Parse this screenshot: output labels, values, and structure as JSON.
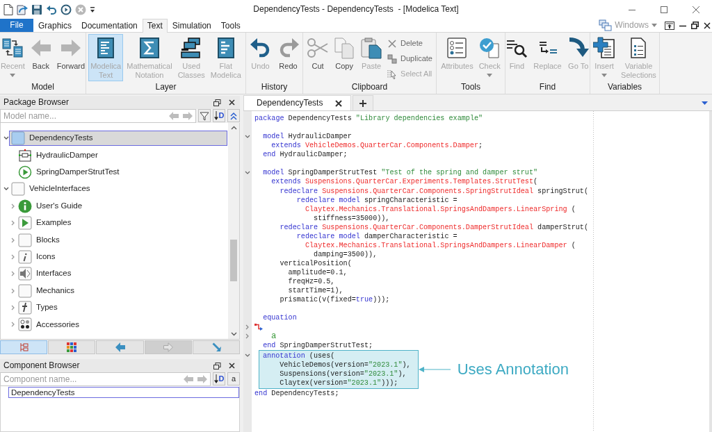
{
  "title_bar": {
    "title": "DependencyTests - DependencyTests  - [Modelica Text]"
  },
  "ribbon_tabs": [
    {
      "label": "File",
      "kind": "file",
      "selected": false
    },
    {
      "label": "Graphics",
      "kind": "tab",
      "selected": false
    },
    {
      "label": "Documentation",
      "kind": "tab",
      "selected": false
    },
    {
      "label": "Text",
      "kind": "tab",
      "selected": true
    },
    {
      "label": "Simulation",
      "kind": "tab",
      "selected": false
    },
    {
      "label": "Tools",
      "kind": "tab",
      "selected": false
    }
  ],
  "window_menu": {
    "label": "Windows",
    "disabled": true
  },
  "ribbon_groups": [
    {
      "label": "Model",
      "buttons": [
        {
          "label": "Recent",
          "kind": "large",
          "disabled": true,
          "dropdown": true
        },
        {
          "label": "Back",
          "kind": "large",
          "disabled": false
        },
        {
          "label": "Forward",
          "kind": "large",
          "disabled": false
        }
      ]
    },
    {
      "label": "Layer",
      "buttons": [
        {
          "label": "Modelica\nText",
          "kind": "large",
          "disabled": true,
          "selected": true
        },
        {
          "label": "Mathematical\nNotation",
          "kind": "large",
          "disabled": true,
          "selected": false
        },
        {
          "label": "Used\nClasses",
          "kind": "large",
          "disabled": true,
          "selected": false
        },
        {
          "label": "Flat\nModelica",
          "kind": "large",
          "disabled": true,
          "selected": false
        }
      ]
    },
    {
      "label": "History",
      "buttons": [
        {
          "label": "Undo",
          "kind": "large",
          "disabled": true
        },
        {
          "label": "Redo",
          "kind": "large",
          "disabled": false
        }
      ]
    },
    {
      "label": "Clipboard",
      "buttons": [
        {
          "label": "Cut",
          "kind": "large",
          "disabled": false
        },
        {
          "label": "Copy",
          "kind": "large",
          "disabled": false
        },
        {
          "label": "Paste",
          "kind": "large",
          "disabled": true
        },
        {
          "label": "Delete",
          "kind": "small",
          "disabled": false
        },
        {
          "label": "Duplicate",
          "kind": "small",
          "disabled": false
        },
        {
          "label": "Select All",
          "kind": "small",
          "disabled": true
        }
      ]
    },
    {
      "label": "Tools",
      "buttons": [
        {
          "label": "Attributes",
          "kind": "large",
          "disabled": true
        },
        {
          "label": "Check",
          "kind": "large",
          "disabled": true,
          "dropdown": true
        }
      ]
    },
    {
      "label": "Find",
      "buttons": [
        {
          "label": "Find",
          "kind": "large",
          "disabled": true
        },
        {
          "label": "Replace",
          "kind": "large",
          "disabled": true
        },
        {
          "label": "Go To",
          "kind": "large",
          "disabled": true
        }
      ]
    },
    {
      "label": "Variables",
      "buttons": [
        {
          "label": "Insert",
          "kind": "large",
          "disabled": true,
          "dropdown": true
        },
        {
          "label": "Variable\nSelections",
          "kind": "large",
          "disabled": true
        }
      ]
    }
  ],
  "package_browser": {
    "title": "Package Browser",
    "search": {
      "placeholder": "Model name..."
    },
    "sort_button": {
      "label": "D"
    },
    "tree": [
      {
        "label": "DependencyTests",
        "expanded": true,
        "selected": true,
        "children": [
          {
            "label": "HydraulicDamper",
            "selected": false
          },
          {
            "label": "SpringDamperStrutTest",
            "selected": false
          }
        ]
      },
      {
        "label": "VehicleInterfaces",
        "expanded": true,
        "selected": false,
        "children": [
          {
            "label": "User's Guide",
            "expanded": false,
            "selected": false
          },
          {
            "label": "Examples",
            "expanded": false,
            "selected": false
          },
          {
            "label": "Blocks",
            "expanded": false,
            "selected": false
          },
          {
            "label": "Icons",
            "expanded": false,
            "selected": false
          },
          {
            "label": "Interfaces",
            "expanded": false,
            "selected": false
          },
          {
            "label": "Mechanics",
            "expanded": false,
            "selected": false
          },
          {
            "label": "Types",
            "expanded": false,
            "selected": false
          },
          {
            "label": "Accessories",
            "expanded": false,
            "selected": false
          }
        ]
      }
    ],
    "view_buttons": [
      {
        "selected": true,
        "disabled": false
      },
      {
        "selected": false,
        "disabled": false
      },
      {
        "selected": false,
        "disabled": false
      },
      {
        "selected": false,
        "disabled": true
      },
      {
        "selected": false,
        "disabled": false
      }
    ]
  },
  "component_browser": {
    "title": "Component Browser",
    "search": {
      "placeholder": "Component name..."
    },
    "sort_button": {
      "label": "D"
    },
    "text_button": {
      "label": "a"
    },
    "items": [
      {
        "label": "DependencyTests",
        "selected": true
      }
    ]
  },
  "editor": {
    "tabs": [
      {
        "label": "DependencyTests",
        "selected": true
      }
    ],
    "lines": [
      {
        "kind": "code",
        "spans": [
          {
            "kind": "keyword",
            "text": "package"
          },
          {
            "kind": "plain",
            "text": " DependencyTests "
          },
          {
            "kind": "string",
            "text": "\"Library dependencies example\""
          }
        ]
      },
      {
        "kind": "blank"
      },
      {
        "kind": "code",
        "expanded": true,
        "spans": [
          {
            "kind": "keyword",
            "text": "  model"
          },
          {
            "kind": "plain",
            "text": " HydraulicDamper"
          }
        ]
      },
      {
        "kind": "code",
        "spans": [
          {
            "kind": "keyword",
            "text": "    extends "
          },
          {
            "kind": "class",
            "text": "VehicleDemos.QuarterCar.Components.Damper"
          },
          {
            "kind": "plain",
            "text": ";"
          }
        ]
      },
      {
        "kind": "code",
        "spans": [
          {
            "kind": "keyword",
            "text": "  end"
          },
          {
            "kind": "plain",
            "text": " HydraulicDamper;"
          }
        ]
      },
      {
        "kind": "blank"
      },
      {
        "kind": "code",
        "expanded": true,
        "spans": [
          {
            "kind": "keyword",
            "text": "  model "
          },
          {
            "kind": "plain",
            "text": "SpringDamperStrutTest "
          },
          {
            "kind": "string",
            "text": "\"Test of the spring and damper strut\""
          }
        ]
      },
      {
        "kind": "code",
        "spans": [
          {
            "kind": "keyword",
            "text": "    extends "
          },
          {
            "kind": "class",
            "text": "Suspensions.QuarterCar.Experiments.Templates.StrutTest"
          },
          {
            "kind": "plain",
            "text": "("
          }
        ]
      },
      {
        "kind": "code",
        "spans": [
          {
            "kind": "keyword",
            "text": "      redeclare "
          },
          {
            "kind": "class",
            "text": "Suspensions.QuarterCar.Components.SpringStrutIdeal"
          },
          {
            "kind": "plain",
            "text": " springStrut("
          }
        ]
      },
      {
        "kind": "code",
        "spans": [
          {
            "kind": "keyword",
            "text": "          redeclare model "
          },
          {
            "kind": "plain",
            "text": "springCharacteristic ="
          }
        ]
      },
      {
        "kind": "code",
        "spans": [
          {
            "kind": "class",
            "text": "            Claytex.Mechanics.Translational.SpringsAndDampers.LinearSpring"
          },
          {
            "kind": "plain",
            "text": " ("
          }
        ]
      },
      {
        "kind": "code",
        "spans": [
          {
            "kind": "plain",
            "text": "              stiffness=35000)),"
          }
        ]
      },
      {
        "kind": "code",
        "spans": [
          {
            "kind": "keyword",
            "text": "      redeclare "
          },
          {
            "kind": "class",
            "text": "Suspensions.QuarterCar.Components.DamperStrutIdeal"
          },
          {
            "kind": "plain",
            "text": " damperStrut("
          }
        ]
      },
      {
        "kind": "code",
        "spans": [
          {
            "kind": "keyword",
            "text": "          redeclare model "
          },
          {
            "kind": "plain",
            "text": "damperCharacteristic ="
          }
        ]
      },
      {
        "kind": "code",
        "spans": [
          {
            "kind": "class",
            "text": "            Claytex.Mechanics.Translational.SpringsAndDampers.LinearDamper"
          },
          {
            "kind": "plain",
            "text": " ("
          }
        ]
      },
      {
        "kind": "code",
        "spans": [
          {
            "kind": "plain",
            "text": "              damping=3500)),"
          }
        ]
      },
      {
        "kind": "code",
        "spans": [
          {
            "kind": "plain",
            "text": "      verticalPosition("
          }
        ]
      },
      {
        "kind": "code",
        "spans": [
          {
            "kind": "plain",
            "text": "        amplitude=0.1,"
          }
        ]
      },
      {
        "kind": "code",
        "spans": [
          {
            "kind": "plain",
            "text": "        freqHz=0.5,"
          }
        ]
      },
      {
        "kind": "code",
        "spans": [
          {
            "kind": "plain",
            "text": "        startTime=1),"
          }
        ]
      },
      {
        "kind": "code",
        "spans": [
          {
            "kind": "plain",
            "text": "      prismatic(v(fixed="
          },
          {
            "kind": "keyword",
            "text": "true"
          },
          {
            "kind": "plain",
            "text": ")));"
          }
        ]
      },
      {
        "kind": "blank"
      },
      {
        "kind": "code",
        "spans": [
          {
            "kind": "keyword",
            "text": "  equation"
          }
        ]
      },
      {
        "kind": "graphic",
        "expanded": false
      },
      {
        "kind": "code",
        "expanded": false,
        "spans": [
          {
            "kind": "comment",
            "text": "    a"
          }
        ]
      },
      {
        "kind": "code",
        "spans": [
          {
            "kind": "keyword",
            "text": "  end"
          },
          {
            "kind": "plain",
            "text": " SpringDamperStrutTest;"
          }
        ]
      },
      {
        "kind": "highlight",
        "callout": {
          "label": "Uses Annotation"
        },
        "lines": [
          {
            "kind": "code",
            "expanded": true,
            "spans": [
              {
                "kind": "keyword",
                "text": "  annotation"
              },
              {
                "kind": "plain",
                "text": " (uses("
              }
            ]
          },
          {
            "kind": "code",
            "spans": [
              {
                "kind": "plain",
                "text": "      VehicleDemos(version="
              },
              {
                "kind": "string",
                "text": "\"2023.1\""
              },
              {
                "kind": "plain",
                "text": "),"
              }
            ]
          },
          {
            "kind": "code",
            "spans": [
              {
                "kind": "plain",
                "text": "      Suspensions(version="
              },
              {
                "kind": "string",
                "text": "\"2023.1\""
              },
              {
                "kind": "plain",
                "text": "),"
              }
            ]
          },
          {
            "kind": "code",
            "spans": [
              {
                "kind": "plain",
                "text": "      Claytex(version="
              },
              {
                "kind": "string",
                "text": "\"2023.1\""
              },
              {
                "kind": "plain",
                "text": ")));"
              }
            ]
          }
        ]
      },
      {
        "kind": "code",
        "spans": [
          {
            "kind": "keyword",
            "text": "end"
          },
          {
            "kind": "plain",
            "text": " DependencyTests;"
          }
        ]
      }
    ]
  }
}
